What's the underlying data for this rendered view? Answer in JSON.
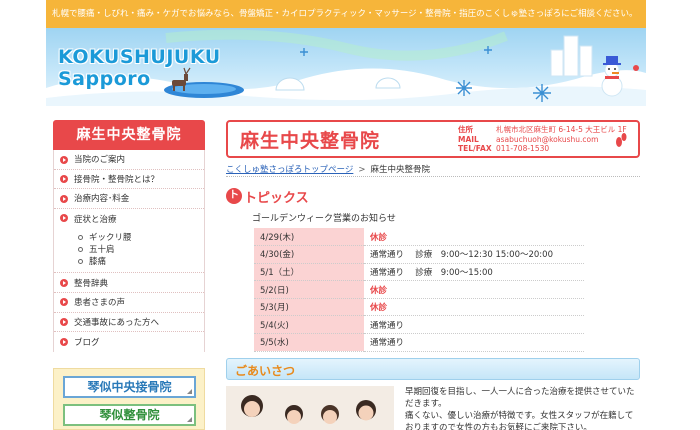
{
  "header": {
    "tagline": "札幌で腰痛・しびれ・痛み・ケガでお悩みなら、骨盤矯正・カイロプラクティック・マッサージ・整骨院・指圧のこくしゅ塾さっぽろにご相談ください。",
    "logo_line1": "KOKUSHUJUKU",
    "logo_line2": "Sapporo"
  },
  "sidebar": {
    "title": "麻生中央整骨院",
    "items": [
      {
        "label": "当院のご案内"
      },
      {
        "label": "接骨院・整骨院とは？"
      },
      {
        "label": "治療内容･料金"
      },
      {
        "label": "症状と治療"
      }
    ],
    "sub_items": [
      {
        "label": "ギックリ腰"
      },
      {
        "label": "五十肩"
      },
      {
        "label": "膝痛"
      }
    ],
    "items2": [
      {
        "label": "整骨辞典"
      },
      {
        "label": "患者さまの声"
      },
      {
        "label": "交通事故にあった方へ"
      },
      {
        "label": "ブログ"
      }
    ],
    "link1": "琴似中央接骨院",
    "link2": "琴似整骨院"
  },
  "clinic": {
    "name": "麻生中央整骨院",
    "address_label": "住所",
    "address": "札幌市北区麻生町 6-14-5 大王ビル 1F",
    "mail_label": "MAIL",
    "mail": "asabuchuoh@kokushu.com",
    "tel_label": "TEL/FAX",
    "tel": "011-708-1530"
  },
  "breadcrumb": {
    "home": "こくしゅ塾さっぽろトップページ",
    "separator": ">",
    "current": "麻生中央整骨院"
  },
  "topics": {
    "icon_letter": "ト",
    "title": "トピックス",
    "subtitle": "ゴールデンウィーク営業のお知らせ",
    "rows": [
      {
        "date": "4/29(木)",
        "text": "休診",
        "rest": true
      },
      {
        "date": "4/30(金)",
        "text": "通常通り　 診療　9:00～12:30  15:00～20:00",
        "rest": false
      },
      {
        "date": "5/1（土）",
        "text": "通常通り　 診療　9:00～15:00",
        "rest": false
      },
      {
        "date": "5/2(日)",
        "text": "休診",
        "rest": true
      },
      {
        "date": "5/3(月)",
        "text": "休診",
        "rest": true
      },
      {
        "date": "5/4(火)",
        "text": "通常通り",
        "rest": false
      },
      {
        "date": "5/5(水)",
        "text": "通常通り",
        "rest": false
      }
    ]
  },
  "greeting": {
    "title": "ごあいさつ",
    "line1": "早期回復を目指し、一人一人に合った治療を提供させていただきます。",
    "line2": "痛くない、優しい治療が特徴です。女性スタッフが在籍しておりますので女性の方もお気軽にご来院下さい。"
  },
  "colors": {
    "accent_red": "#e8484a",
    "header_orange": "#f6b53a",
    "link_blue": "#2a62b8"
  }
}
